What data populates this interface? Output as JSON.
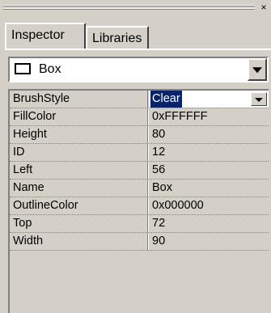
{
  "window": {
    "close_glyph": "×"
  },
  "tabs": [
    {
      "label": "Inspector",
      "active": true
    },
    {
      "label": "Libraries",
      "active": false
    }
  ],
  "object_selector": {
    "value": "Box"
  },
  "properties": [
    {
      "name": "BrushStyle",
      "value": "Clear",
      "selected": true
    },
    {
      "name": "FillColor",
      "value": "0xFFFFFF"
    },
    {
      "name": "Height",
      "value": "80"
    },
    {
      "name": "ID",
      "value": "12"
    },
    {
      "name": "Left",
      "value": "56"
    },
    {
      "name": "Name",
      "value": "Box"
    },
    {
      "name": "OutlineColor",
      "value": "0x000000"
    },
    {
      "name": "Top",
      "value": "72"
    },
    {
      "name": "Width",
      "value": "90"
    }
  ],
  "colors": {
    "selection": "#0a246a",
    "face": "#d4d0c8"
  }
}
